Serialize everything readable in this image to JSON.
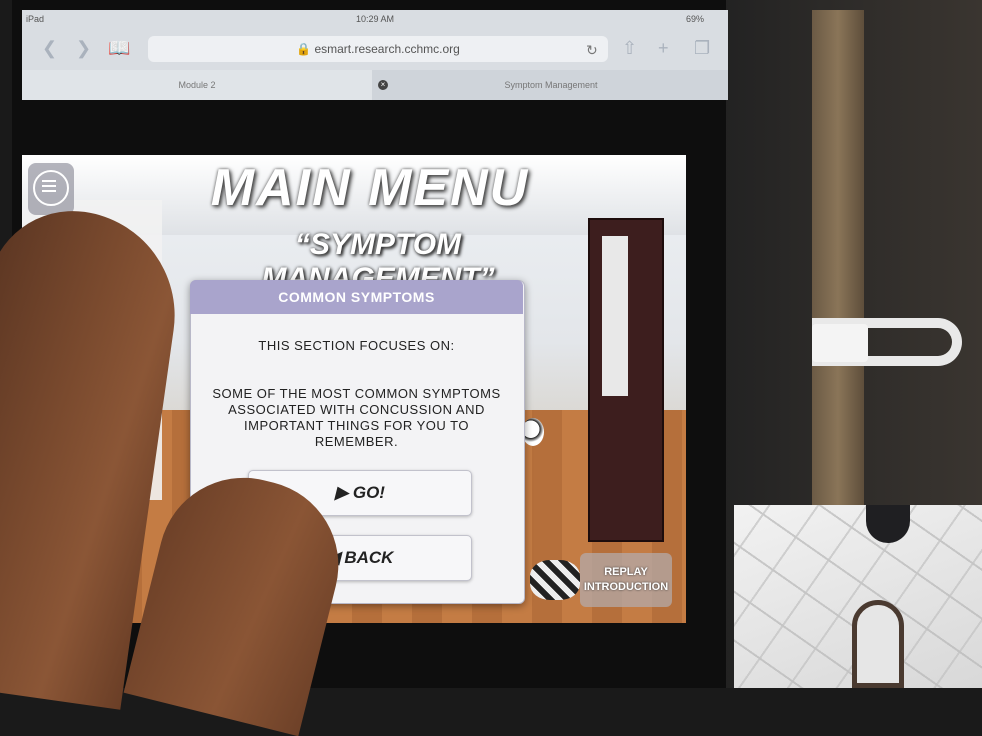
{
  "status": {
    "device": "iPad",
    "time": "10:29 AM",
    "battery": "69%"
  },
  "browser": {
    "url": "esmart.research.cchmc.org",
    "tabs": [
      {
        "label": "Module 2"
      },
      {
        "label": "Symptom Management"
      }
    ]
  },
  "game": {
    "title": "MAIN MENU",
    "subtitle": "“SYMPTOM MANAGEMENT”",
    "dialog": {
      "header": "COMMON SYMPTOMS",
      "intro": "THIS SECTION FOCUSES ON:",
      "body_lines": [
        "SOME OF THE MOST COMMON SYMPTOMS",
        "ASSOCIATED WITH CONCUSSION AND",
        "IMPORTANT THINGS FOR YOU TO",
        "REMEMBER."
      ],
      "go_label": "▶ GO!",
      "back_label": "◀ BACK"
    },
    "replay_lines": [
      "REPLAY",
      "INTRODUCTION"
    ]
  },
  "icons": {
    "back": "chevron-left-icon",
    "forward": "chevron-right-icon",
    "bookmarks": "book-icon",
    "reload": "reload-icon",
    "share": "share-icon",
    "new_tab": "plus-icon",
    "tabs": "tabs-icon",
    "menu": "hamburger-icon",
    "lock": "lock-icon"
  },
  "colors": {
    "dialog_header": "#a9a4cc",
    "browser_chrome": "#d9dde2"
  }
}
